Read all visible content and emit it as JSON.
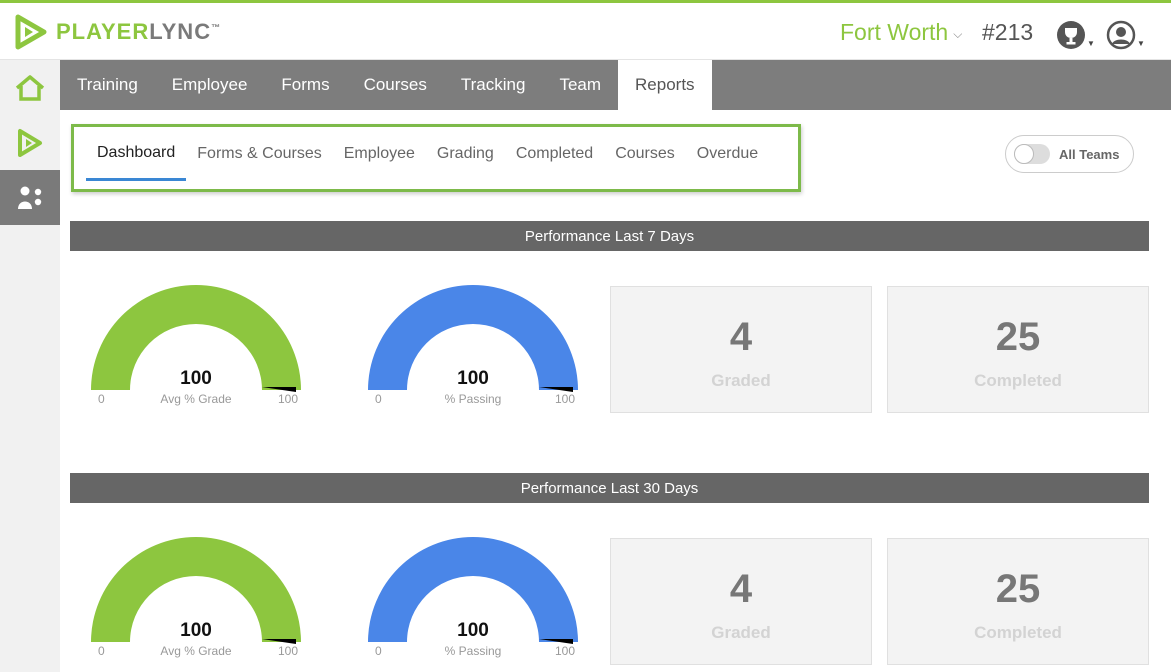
{
  "brand": {
    "name_part1": "PLAYER",
    "name_part2": "LYNC",
    "trademark": "™",
    "accent": "#8dc63f"
  },
  "header": {
    "location": "Fort Worth",
    "store_number": "#213",
    "trophy_icon": "trophy-icon",
    "user_icon": "user-icon"
  },
  "sidebar": {
    "items": [
      {
        "icon": "home-icon"
      },
      {
        "icon": "play-icon"
      },
      {
        "icon": "people-icon"
      }
    ]
  },
  "nav": {
    "tabs": [
      "Training",
      "Employee",
      "Forms",
      "Courses",
      "Tracking",
      "Team",
      "Reports"
    ],
    "active": "Reports"
  },
  "subtabs": {
    "items": [
      "Dashboard",
      "Forms & Courses",
      "Employee",
      "Grading",
      "Completed",
      "Courses",
      "Overdue"
    ],
    "active": "Dashboard"
  },
  "toggle": {
    "label": "All Teams",
    "on": false
  },
  "sections": [
    {
      "title": "Performance Last 7 Days",
      "gauges": [
        {
          "value": "100",
          "label": "Avg % Grade",
          "min": "0",
          "max": "100",
          "color": "#8dc63f"
        },
        {
          "value": "100",
          "label": "% Passing",
          "min": "0",
          "max": "100",
          "color": "#4a86e8"
        }
      ],
      "stats": [
        {
          "value": "4",
          "label": "Graded"
        },
        {
          "value": "25",
          "label": "Completed"
        }
      ]
    },
    {
      "title": "Performance Last 30 Days",
      "gauges": [
        {
          "value": "100",
          "label": "Avg % Grade",
          "min": "0",
          "max": "100",
          "color": "#8dc63f"
        },
        {
          "value": "100",
          "label": "% Passing",
          "min": "0",
          "max": "100",
          "color": "#4a86e8"
        }
      ],
      "stats": [
        {
          "value": "4",
          "label": "Graded"
        },
        {
          "value": "25",
          "label": "Completed"
        }
      ]
    }
  ]
}
